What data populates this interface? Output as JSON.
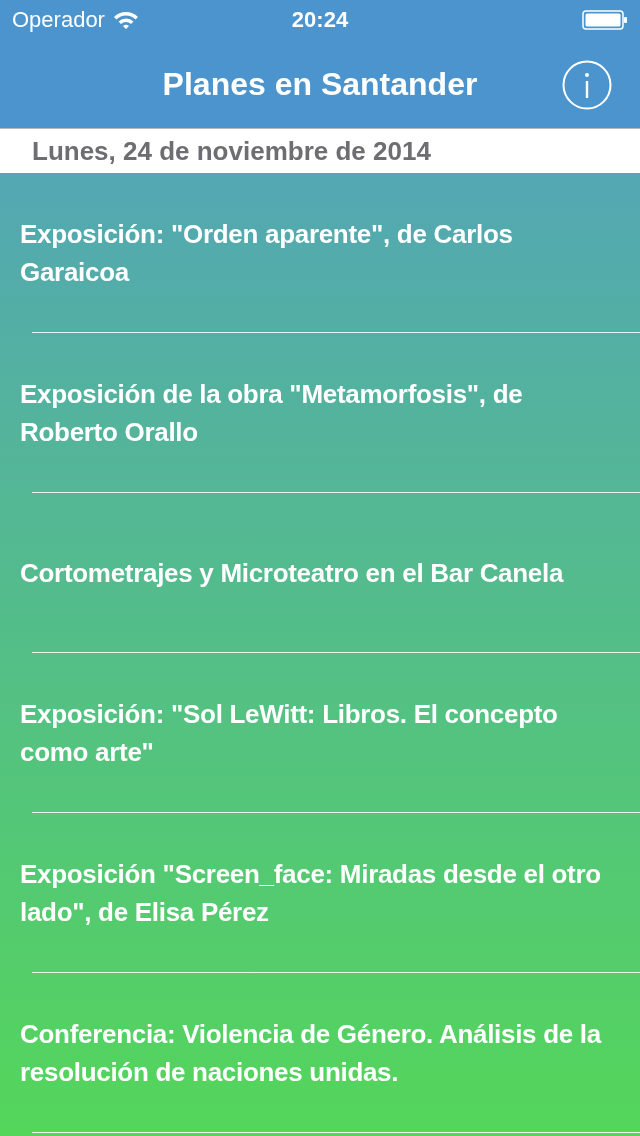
{
  "status_bar": {
    "carrier": "Operador",
    "time": "20:24"
  },
  "nav_bar": {
    "title": "Planes en Santander"
  },
  "section": {
    "header": "Lunes, 24 de noviembre de 2014"
  },
  "events": [
    {
      "title": "Exposición: \"Orden aparente\", de Carlos Garaicoa"
    },
    {
      "title": "Exposición de la obra \"Metamorfosis\", de Roberto Orallo"
    },
    {
      "title": "Cortometrajes y Microteatro en el Bar Canela"
    },
    {
      "title": "Exposición: \"Sol LeWitt: Libros. El concepto como arte\""
    },
    {
      "title": "Exposición \"Screen_face: Miradas desde el otro lado\", de Elisa Pérez"
    },
    {
      "title": "Conferencia: Violencia de Género. Análisis de la resolución de naciones unidas."
    }
  ]
}
